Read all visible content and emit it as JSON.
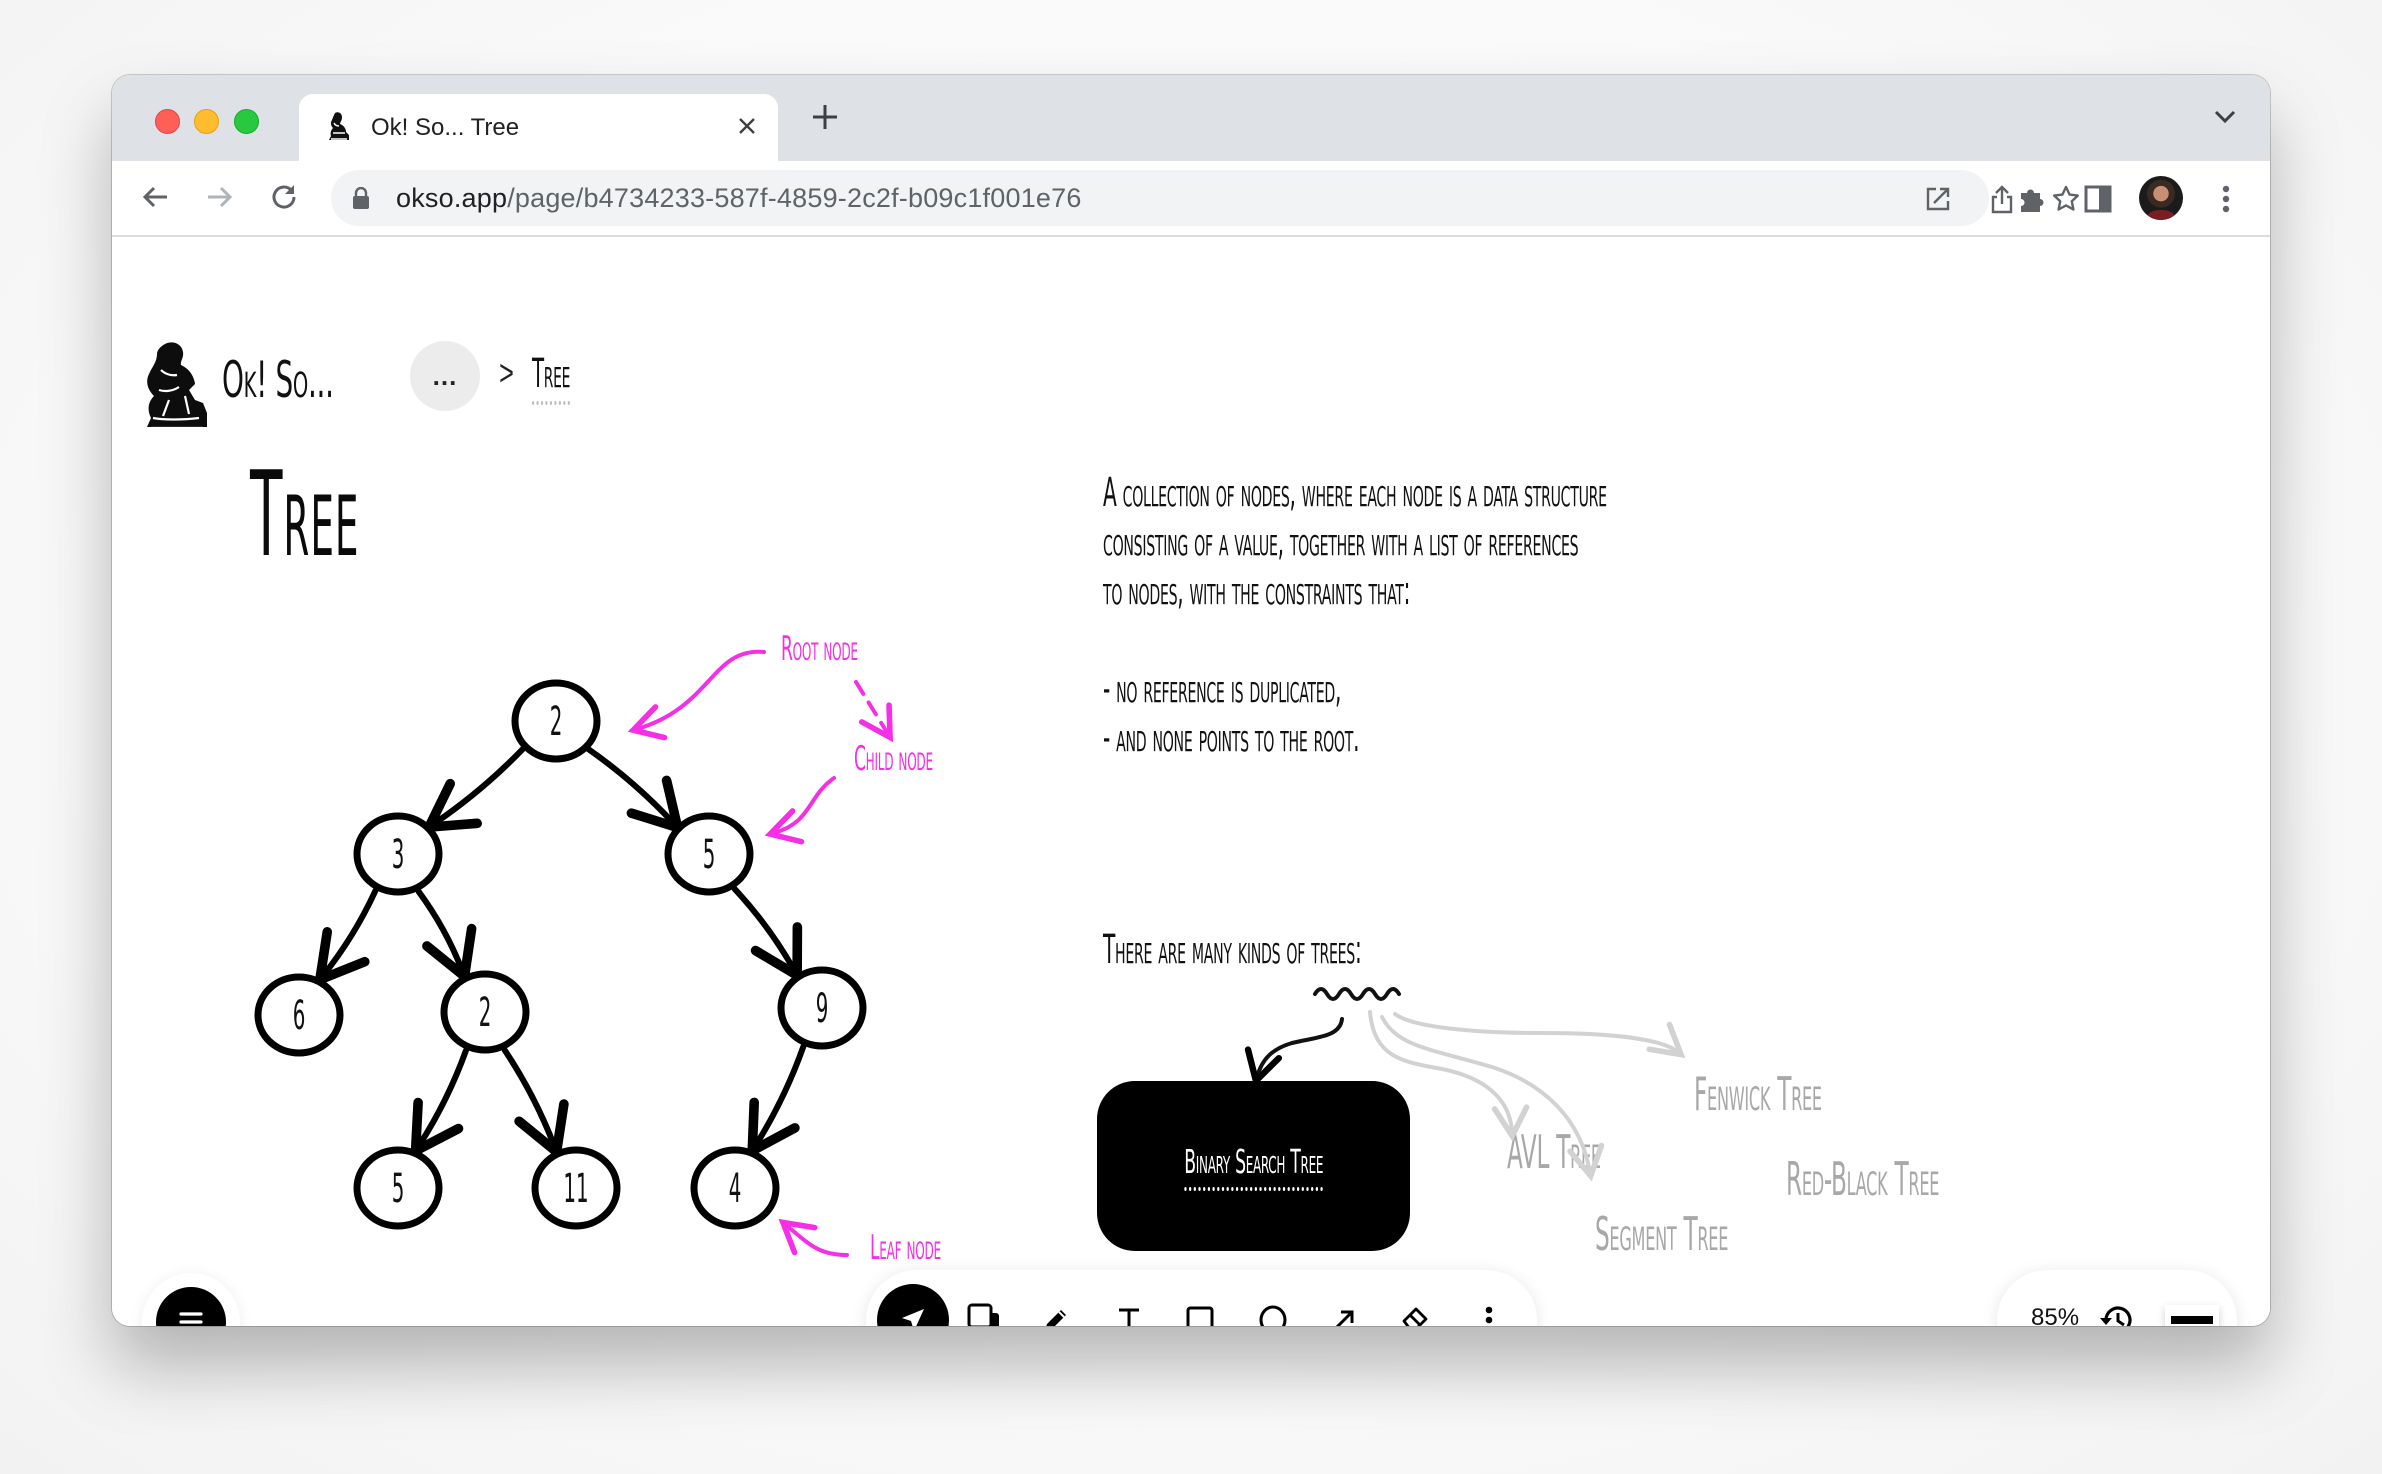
{
  "browser": {
    "tab": {
      "title": "Ok! So... Tree",
      "favicon": "thinker-statue-icon",
      "close_icon": "close-icon"
    },
    "new_tab_icon": "plus-icon",
    "tab_list_icon": "chevron-down-icon",
    "nav": {
      "back_icon": "arrow-left-icon",
      "forward_icon": "arrow-right-icon",
      "reload_icon": "reload-icon"
    },
    "url": {
      "host": "okso.app",
      "path": "/page/b4734233-587f-4859-2c2f-b09c1f001e76"
    },
    "omnibox_icons": [
      "open-in-new-icon",
      "share-icon",
      "star-icon"
    ],
    "toolbar_icons": [
      "extensions-puzzle-icon",
      "side-panel-icon",
      "profile-avatar",
      "kebab-menu-icon"
    ]
  },
  "app": {
    "brand": "Ok! So...",
    "breadcrumb": {
      "more_label": "...",
      "separator": ">",
      "current": "Tree"
    },
    "page_title": "Tree",
    "description_lines": [
      "A collection of nodes, where each node is a data structure",
      "consisting of a value, together with a list of references",
      "to nodes, with the constraints that:",
      "",
      "-  no reference is duplicated,",
      "- and none points to the root."
    ],
    "kinds_title": "There are many kinds of trees:",
    "kinds": {
      "highlighted": "Binary Search Tree",
      "others": [
        "Fenwick Tree",
        "AVL Tree",
        "Red-Black Tree",
        "Segment Tree"
      ]
    },
    "annotations": {
      "root": "Root node",
      "child": "Child node",
      "leaf": "Leaf node",
      "color": "#f52fe6"
    },
    "tree": {
      "nodes": [
        {
          "id": "n1",
          "value": "2",
          "parent": null
        },
        {
          "id": "n2",
          "value": "3",
          "parent": "n1"
        },
        {
          "id": "n3",
          "value": "5",
          "parent": "n1"
        },
        {
          "id": "n4",
          "value": "6",
          "parent": "n2"
        },
        {
          "id": "n5",
          "value": "2",
          "parent": "n2"
        },
        {
          "id": "n6",
          "value": "9",
          "parent": "n3"
        },
        {
          "id": "n7",
          "value": "5",
          "parent": "n5"
        },
        {
          "id": "n8",
          "value": "11",
          "parent": "n5"
        },
        {
          "id": "n9",
          "value": "4",
          "parent": "n6"
        }
      ]
    }
  },
  "bottom_toolbar": {
    "menu_icon": "hamburger-menu-icon",
    "tools": [
      {
        "name": "select",
        "icon": "navigation-arrow-icon",
        "active": true
      },
      {
        "name": "layers",
        "icon": "copy-layers-icon",
        "active": false
      },
      {
        "name": "pencil",
        "icon": "pencil-icon",
        "active": false
      },
      {
        "name": "text",
        "icon": "text-icon",
        "active": false
      },
      {
        "name": "rectangle",
        "icon": "rectangle-icon",
        "active": false
      },
      {
        "name": "ellipse",
        "icon": "circle-icon",
        "active": false
      },
      {
        "name": "arrow",
        "icon": "arrow-icon",
        "active": false
      },
      {
        "name": "eraser",
        "icon": "eraser-icon",
        "active": false
      },
      {
        "name": "more",
        "icon": "more-vertical-icon",
        "active": false
      }
    ],
    "zoom": "85%",
    "history_icon": "history-icon",
    "stroke_icon": "stroke-width-icon"
  }
}
